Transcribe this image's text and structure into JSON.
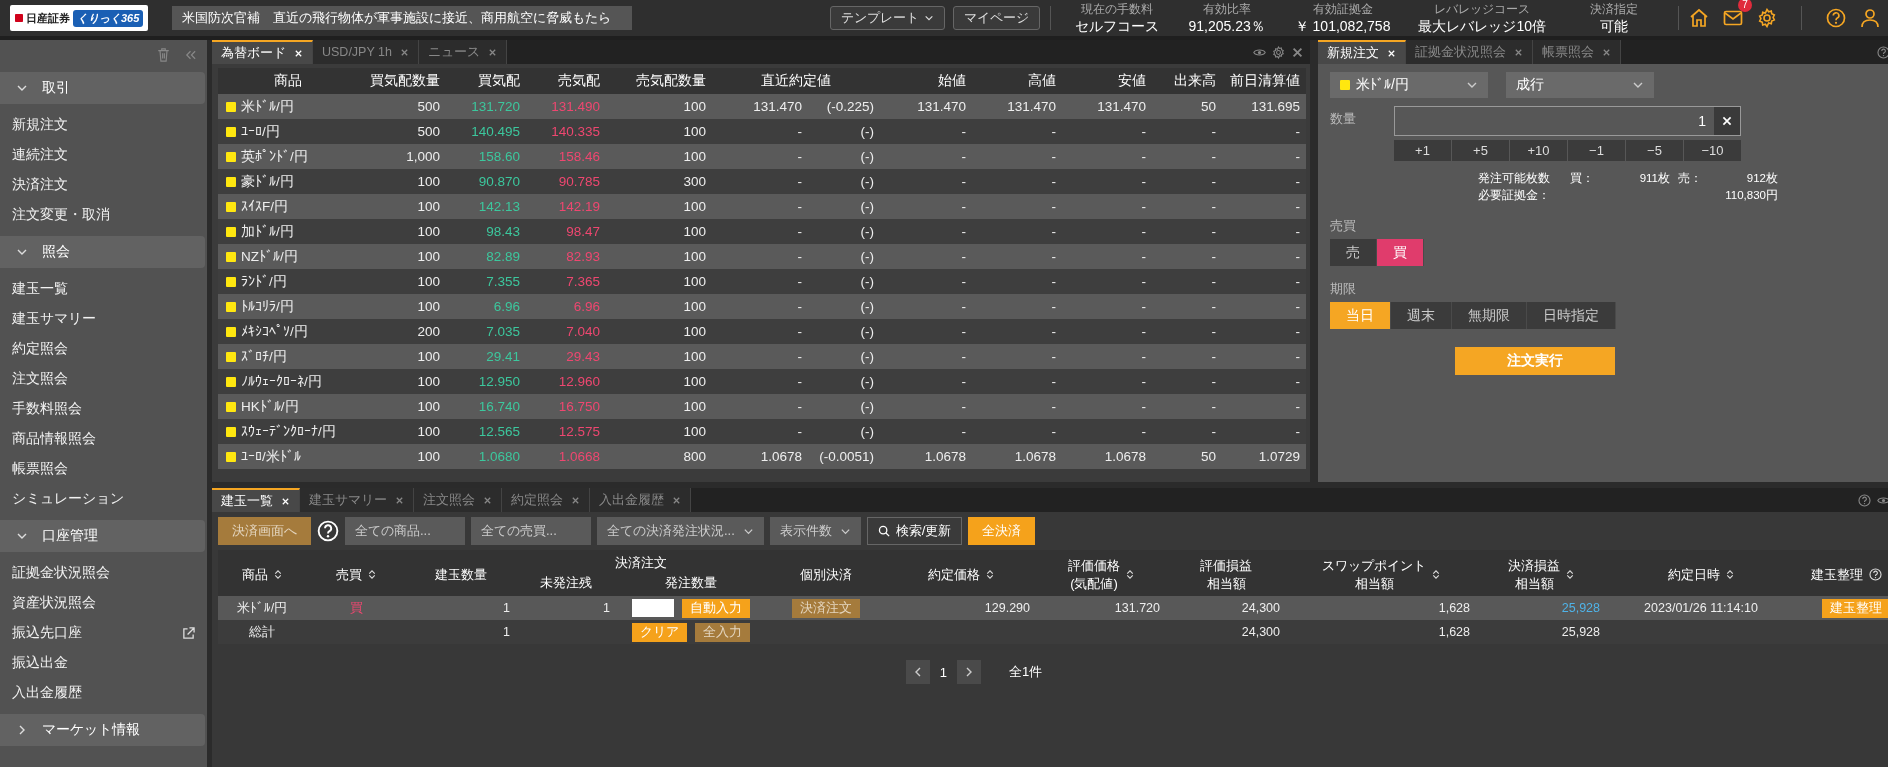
{
  "top_bar": {
    "logo_text": "日産証券",
    "logo_badge": "くりっく365",
    "news": "米国防次官補　直近の飛行物体が軍事施設に接近、商用航空に脅威もたら",
    "buttons": [
      {
        "label": "テンプレート",
        "caret": true
      },
      {
        "label": "マイページ",
        "caret": false
      }
    ],
    "stats": [
      {
        "label": "現在の手数料",
        "value": "セルフコース"
      },
      {
        "label": "有効比率",
        "value": "91,205.23％"
      },
      {
        "label": "有効証拠金",
        "value": "￥ 101,082,758"
      },
      {
        "label": "レバレッジコース",
        "value": "最大レバレッジ10倍"
      },
      {
        "label": "決済指定",
        "value": "可能"
      }
    ],
    "notification_count": "7"
  },
  "sidebar": {
    "sections": [
      {
        "title": "取引",
        "expanded": true,
        "items": [
          {
            "label": "新規注文",
            "external": false
          },
          {
            "label": "連続注文",
            "external": false
          },
          {
            "label": "決済注文",
            "external": false
          },
          {
            "label": "注文変更・取消",
            "external": false
          }
        ]
      },
      {
        "title": "照会",
        "expanded": true,
        "items": [
          {
            "label": "建玉一覧",
            "external": false
          },
          {
            "label": "建玉サマリー",
            "external": false
          },
          {
            "label": "約定照会",
            "external": false
          },
          {
            "label": "注文照会",
            "external": false
          },
          {
            "label": "手数料照会",
            "external": false
          },
          {
            "label": "商品情報照会",
            "external": false
          },
          {
            "label": "帳票照会",
            "external": false
          },
          {
            "label": "シミュレーション",
            "external": false
          }
        ]
      },
      {
        "title": "口座管理",
        "expanded": true,
        "items": [
          {
            "label": "証拠金状況照会",
            "external": false
          },
          {
            "label": "資産状況照会",
            "external": false
          },
          {
            "label": "振込先口座",
            "external": true
          },
          {
            "label": "振込出金",
            "external": false
          },
          {
            "label": "入出金履歴",
            "external": false
          }
        ]
      },
      {
        "title": "マーケット情報",
        "expanded": false
      }
    ]
  },
  "board": {
    "tabs": [
      {
        "label": "為替ボード",
        "selected": true
      },
      {
        "label": "USD/JPY 1h",
        "selected": false
      },
      {
        "label": "ニュース",
        "selected": false
      }
    ],
    "columns": [
      "商品",
      "買気配数量",
      "買気配",
      "売気配",
      "売気配数量",
      "直近約定値",
      "始値",
      "高値",
      "安値",
      "出来高",
      "前日清算値"
    ],
    "rows": [
      {
        "name": "米ﾄﾞﾙ/円",
        "bid_qty": "500",
        "bid": "131.720",
        "ask": "131.490",
        "ask_qty": "100",
        "last": "131.470",
        "change": "(-0.225)",
        "open": "131.470",
        "high": "131.470",
        "low": "131.470",
        "volume": "50",
        "prev": "131.695"
      },
      {
        "name": "ﾕｰﾛ/円",
        "bid_qty": "500",
        "bid": "140.495",
        "ask": "140.335",
        "ask_qty": "100",
        "last": "-",
        "change": "(-)",
        "open": "-",
        "high": "-",
        "low": "-",
        "volume": "-",
        "prev": "-"
      },
      {
        "name": "英ﾎﾟﾝﾄﾞ/円",
        "bid_qty": "1,000",
        "bid": "158.60",
        "ask": "158.46",
        "ask_qty": "100",
        "last": "-",
        "change": "(-)",
        "open": "-",
        "high": "-",
        "low": "-",
        "volume": "-",
        "prev": "-"
      },
      {
        "name": "豪ﾄﾞﾙ/円",
        "bid_qty": "100",
        "bid": "90.870",
        "ask": "90.785",
        "ask_qty": "300",
        "last": "-",
        "change": "(-)",
        "open": "-",
        "high": "-",
        "low": "-",
        "volume": "-",
        "prev": "-"
      },
      {
        "name": "ｽｲｽF/円",
        "bid_qty": "100",
        "bid": "142.13",
        "ask": "142.19",
        "ask_qty": "100",
        "last": "-",
        "change": "(-)",
        "open": "-",
        "high": "-",
        "low": "-",
        "volume": "-",
        "prev": "-"
      },
      {
        "name": "加ﾄﾞﾙ/円",
        "bid_qty": "100",
        "bid": "98.43",
        "ask": "98.47",
        "ask_qty": "100",
        "last": "-",
        "change": "(-)",
        "open": "-",
        "high": "-",
        "low": "-",
        "volume": "-",
        "prev": "-"
      },
      {
        "name": "NZﾄﾞﾙ/円",
        "bid_qty": "100",
        "bid": "82.89",
        "ask": "82.93",
        "ask_qty": "100",
        "last": "-",
        "change": "(-)",
        "open": "-",
        "high": "-",
        "low": "-",
        "volume": "-",
        "prev": "-"
      },
      {
        "name": "ﾗﾝﾄﾞ/円",
        "bid_qty": "100",
        "bid": "7.355",
        "ask": "7.365",
        "ask_qty": "100",
        "last": "-",
        "change": "(-)",
        "open": "-",
        "high": "-",
        "low": "-",
        "volume": "-",
        "prev": "-"
      },
      {
        "name": "ﾄﾙｺﾘﾗ/円",
        "bid_qty": "100",
        "bid": "6.96",
        "ask": "6.96",
        "ask_qty": "100",
        "last": "-",
        "change": "(-)",
        "open": "-",
        "high": "-",
        "low": "-",
        "volume": "-",
        "prev": "-"
      },
      {
        "name": "ﾒｷｼｺﾍﾟｿ/円",
        "bid_qty": "200",
        "bid": "7.035",
        "ask": "7.040",
        "ask_qty": "100",
        "last": "-",
        "change": "(-)",
        "open": "-",
        "high": "-",
        "low": "-",
        "volume": "-",
        "prev": "-"
      },
      {
        "name": "ｽﾞﾛﾁ/円",
        "bid_qty": "100",
        "bid": "29.41",
        "ask": "29.43",
        "ask_qty": "100",
        "last": "-",
        "change": "(-)",
        "open": "-",
        "high": "-",
        "low": "-",
        "volume": "-",
        "prev": "-"
      },
      {
        "name": "ﾉﾙｳｪｰｸﾛｰﾈ/円",
        "bid_qty": "100",
        "bid": "12.950",
        "ask": "12.960",
        "ask_qty": "100",
        "last": "-",
        "change": "(-)",
        "open": "-",
        "high": "-",
        "low": "-",
        "volume": "-",
        "prev": "-"
      },
      {
        "name": "HKﾄﾞﾙ/円",
        "bid_qty": "100",
        "bid": "16.740",
        "ask": "16.750",
        "ask_qty": "100",
        "last": "-",
        "change": "(-)",
        "open": "-",
        "high": "-",
        "low": "-",
        "volume": "-",
        "prev": "-"
      },
      {
        "name": "ｽｳｪｰﾃﾞﾝｸﾛｰﾅ/円",
        "bid_qty": "100",
        "bid": "12.565",
        "ask": "12.575",
        "ask_qty": "100",
        "last": "-",
        "change": "(-)",
        "open": "-",
        "high": "-",
        "low": "-",
        "volume": "-",
        "prev": "-"
      },
      {
        "name": "ﾕｰﾛ/米ﾄﾞﾙ",
        "bid_qty": "100",
        "bid": "1.0680",
        "ask": "1.0668",
        "ask_qty": "800",
        "last": "1.0678",
        "change": "(-0.0051)",
        "open": "1.0678",
        "high": "1.0678",
        "low": "1.0678",
        "volume": "50",
        "prev": "1.0729"
      }
    ]
  },
  "order": {
    "tabs": [
      {
        "label": "新規注文",
        "selected": true
      },
      {
        "label": "証拠金状況照会",
        "selected": false
      },
      {
        "label": "帳票照会",
        "selected": false
      }
    ],
    "product": "米ﾄﾞﾙ/円",
    "order_type": "成行",
    "quantity_label": "数量",
    "quantity": "1",
    "steps": [
      "+1",
      "+5",
      "+10",
      "−1",
      "−5",
      "−10"
    ],
    "available_label": "発注可能枚数",
    "buy_label": "買：",
    "buy_available": "911枚",
    "sell_label": "売：",
    "sell_available": "912枚",
    "margin_label": "必要証拠金：",
    "margin": "110,830円",
    "side_label": "売買",
    "sides": [
      {
        "label": "売",
        "selected": false
      },
      {
        "label": "買",
        "selected": true
      }
    ],
    "expiry_label": "期限",
    "expiries": [
      {
        "label": "当日",
        "selected": true
      },
      {
        "label": "週末",
        "selected": false
      },
      {
        "label": "無期限",
        "selected": false
      },
      {
        "label": "日時指定",
        "selected": false
      }
    ],
    "submit": "注文実行"
  },
  "positions": {
    "tabs": [
      {
        "label": "建玉一覧",
        "selected": true
      },
      {
        "label": "建玉サマリー",
        "selected": false
      },
      {
        "label": "注文照会",
        "selected": false
      },
      {
        "label": "約定照会",
        "selected": false
      },
      {
        "label": "入出金履歴",
        "selected": false
      }
    ],
    "settle_screen_button": {
      "label": "決済画面へ",
      "disabled": true
    },
    "filters": [
      {
        "value": "全ての商品...",
        "kind": "text"
      },
      {
        "value": "全ての売買...",
        "kind": "text"
      },
      {
        "value": "全ての決済発注状況...",
        "kind": "dropdown"
      },
      {
        "value": "表示件数",
        "kind": "dropdown"
      }
    ],
    "search_button": "検索/更新",
    "settle_all_button": "全決済",
    "columns": [
      {
        "label": "商品",
        "sortable": true
      },
      {
        "label": "売買",
        "sortable": true
      },
      {
        "label": "建玉数量",
        "sortable": false
      },
      {
        "label": "決済注文",
        "sortable": false,
        "sub": [
          "未発注残",
          "発注数量"
        ]
      },
      {
        "label": "個別決済",
        "sortable": false
      },
      {
        "label": "約定価格",
        "sortable": true
      },
      {
        "label": "評価価格",
        "sublabel": "(気配値)",
        "sortable": true
      },
      {
        "label": "評価損益",
        "sublabel": "相当額",
        "sortable": false
      },
      {
        "label": "スワップポイント",
        "sublabel": "相当額",
        "sortable": true
      },
      {
        "label": "決済損益",
        "sublabel": "相当額",
        "sortable": true
      },
      {
        "label": "約定日時",
        "sortable": true
      },
      {
        "label": "建玉整理",
        "sortable": false,
        "help": true
      }
    ],
    "rows": [
      {
        "product": "米ﾄﾞﾙ/円",
        "side": "買",
        "kind": "buy",
        "quantity": "1",
        "unordered": "1",
        "auto_button": "自動入力",
        "settle_button": {
          "label": "決済注文",
          "disabled": true
        },
        "contract_price": "129.290",
        "valuation_price": "131.720",
        "valuation_pl": "24,300",
        "swap": "1,628",
        "settle_pl": "25,928",
        "date": "2023/01/26 11:14:10",
        "organize_button": "建玉整理"
      }
    ],
    "total": {
      "label": "総計",
      "quantity": "1",
      "clear_button": "クリア",
      "fill_all_button": {
        "label": "全入力",
        "disabled": true
      },
      "valuation_pl": "24,300",
      "swap": "1,628",
      "settle_pl": "25,928"
    },
    "pagination": {
      "page": "1",
      "total": "全1件"
    }
  }
}
